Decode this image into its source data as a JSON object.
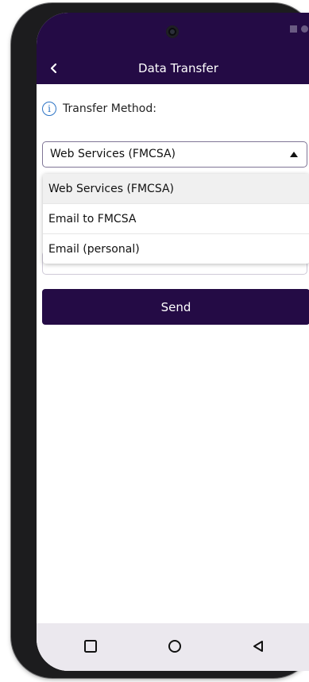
{
  "header": {
    "title": "Data Transfer"
  },
  "transfer": {
    "label": "Transfer Method:",
    "selected_value": "Web Services (FMCSA)",
    "options": [
      "Web Services (FMCSA)",
      "Email to FMCSA",
      "Email (personal)"
    ]
  },
  "actions": {
    "send_label": "Send"
  },
  "colors": {
    "primary": "#240b45",
    "info": "#2d74c5",
    "nav_bar": "#ebe8ee"
  },
  "icons": {
    "back": "chevron-left-icon",
    "info": "info-icon",
    "dropdown": "caret-up-icon",
    "nav_recents": "square-icon",
    "nav_home": "circle-icon",
    "nav_back": "triangle-back-icon"
  }
}
